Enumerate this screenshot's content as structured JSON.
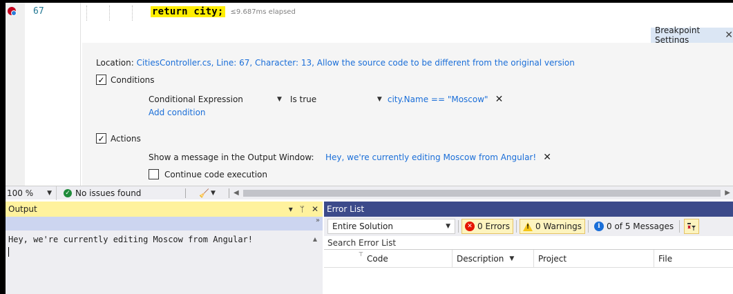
{
  "editor": {
    "line_number": "67",
    "code": "return city;",
    "elapsed": "≤9.687ms elapsed"
  },
  "breakpoint": {
    "tab_label": "Breakpoint Settings",
    "location_label": "Location:",
    "location_value": "CitiesController.cs, Line: 67, Character: 13, Allow the source code to be different from the original version",
    "conditions_label": "Conditions",
    "conditions_checked": true,
    "condition_type": "Conditional Expression",
    "condition_op": "Is true",
    "condition_value": "city.Name == \"Moscow\"",
    "add_condition": "Add condition",
    "actions_label": "Actions",
    "actions_checked": true,
    "show_message_label": "Show a message in the Output Window:",
    "message_value": "Hey, we're currently editing Moscow from Angular!",
    "continue_label": "Continue code execution",
    "continue_checked": false
  },
  "statusbar": {
    "zoom": "100 %",
    "issues": "No issues found"
  },
  "output": {
    "title": "Output",
    "text": "Hey, we're currently editing Moscow from Angular!"
  },
  "error_list": {
    "title": "Error List",
    "scope": "Entire Solution",
    "errors": "0 Errors",
    "warnings": "0 Warnings",
    "messages": "0 of 5 Messages",
    "search_placeholder": "Search Error List",
    "columns": [
      "Code",
      "Description",
      "Project",
      "File"
    ]
  },
  "colors": {
    "highlight": "#ffee00",
    "link": "#1a6ed8",
    "error_list_title": "#3c4a8a",
    "output_title": "#fff29d"
  }
}
